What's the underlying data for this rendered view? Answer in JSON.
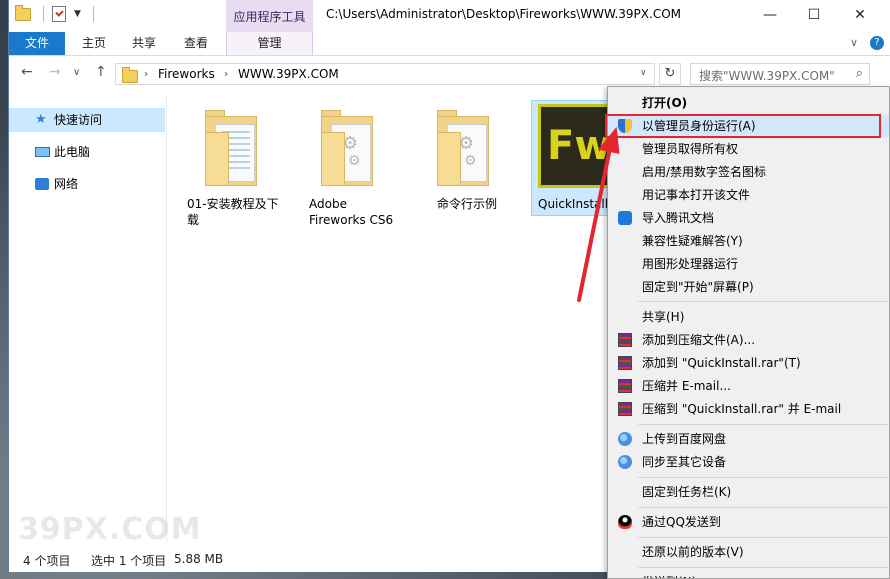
{
  "window": {
    "context_tab_title": "应用程序工具",
    "path_title": "C:\\Users\\Administrator\\Desktop\\Fireworks\\WWW.39PX.COM",
    "controls": {
      "minimize": "—",
      "maximize": "☐",
      "close": "✕"
    }
  },
  "ribbon": {
    "tabs": [
      {
        "label": "文件"
      },
      {
        "label": "主页"
      },
      {
        "label": "共享"
      },
      {
        "label": "查看"
      },
      {
        "label": "管理"
      }
    ],
    "collapse": "∨",
    "help": "?"
  },
  "nav": {
    "back": "←",
    "forward": "→",
    "recent": "∨",
    "up": "↑",
    "breadcrumb": [
      "Fireworks",
      "WWW.39PX.COM"
    ],
    "sep": "›",
    "refresh": "↻",
    "search_placeholder": "搜索\"WWW.39PX.COM\"",
    "search_icon": "⌕"
  },
  "sidebar": {
    "items": [
      {
        "label": "快速访问",
        "icon": "star-icon"
      },
      {
        "label": "此电脑",
        "icon": "computer-icon"
      },
      {
        "label": "网络",
        "icon": "network-icon"
      }
    ]
  },
  "files": [
    {
      "name": "01-安装教程及下载",
      "line1": "01-安装教程及下",
      "line2": "载"
    },
    {
      "name": "Adobe Fireworks CS6",
      "line1": "Adobe",
      "line2": "Fireworks CS6"
    },
    {
      "name": "命令行示例",
      "line1": "命令行示例",
      "line2": ""
    },
    {
      "name": "QuickInstall",
      "line1": "QuickInstall",
      "logo": "Fw"
    }
  ],
  "status": {
    "count": "4 个项目",
    "selected": "选中 1 个项目",
    "size": "5.88 MB"
  },
  "watermark": "39PX.COM",
  "context_menu": {
    "items": [
      {
        "label": "打开(O)",
        "bold": true
      },
      {
        "label": "以管理员身份运行(A)",
        "icon": "shield-icon",
        "highlighted": true
      },
      {
        "label": "管理员取得所有权"
      },
      {
        "label": "启用/禁用数字签名图标"
      },
      {
        "label": "用记事本打开该文件"
      },
      {
        "label": "导入腾讯文档",
        "icon": "tencent-docs-icon"
      },
      {
        "label": "兼容性疑难解答(Y)"
      },
      {
        "label": "用图形处理器运行"
      },
      {
        "label": "固定到\"开始\"屏幕(P)"
      },
      {
        "label": "共享(H)"
      },
      {
        "label": "添加到压缩文件(A)...",
        "icon": "winrar-icon"
      },
      {
        "label": "添加到 \"QuickInstall.rar\"(T)",
        "icon": "winrar-icon"
      },
      {
        "label": "压缩并 E-mail...",
        "icon": "winrar-icon"
      },
      {
        "label": "压缩到 \"QuickInstall.rar\" 并 E-mail",
        "icon": "winrar-icon"
      },
      {
        "label": "上传到百度网盘",
        "icon": "baidu-netdisk-icon"
      },
      {
        "label": "同步至其它设备",
        "icon": "baidu-netdisk-icon"
      },
      {
        "label": "固定到任务栏(K)"
      },
      {
        "label": "通过QQ发送到",
        "icon": "qq-icon"
      },
      {
        "label": "还原以前的版本(V)"
      },
      {
        "label": "发送到(N)"
      }
    ]
  },
  "colors": {
    "accent": "#1979ca",
    "highlight_box": "#e4262e",
    "selection": "#cce8ff",
    "context_tab": "#e8dcf1"
  }
}
